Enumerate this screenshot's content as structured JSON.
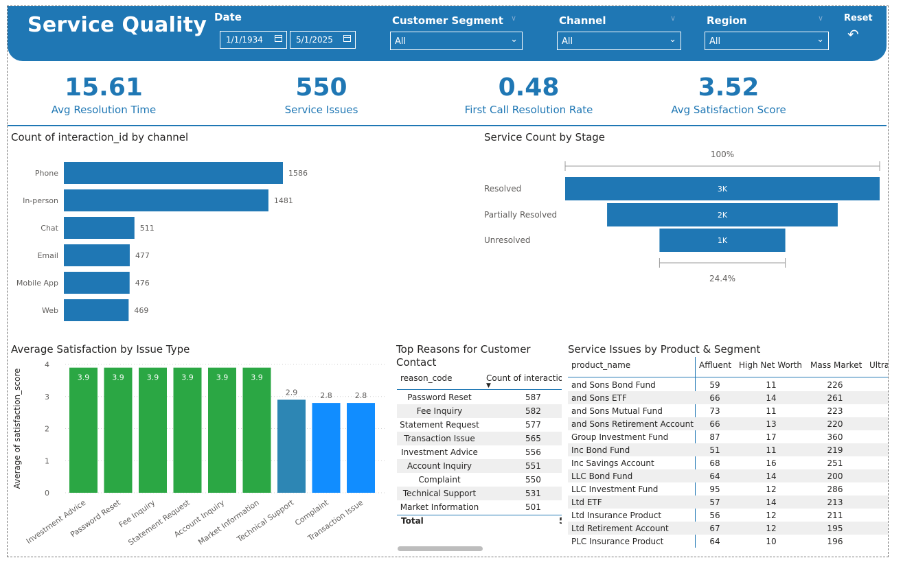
{
  "header": {
    "title": "Service Quality",
    "date_label": "Date",
    "date_start": "1/1/1934",
    "date_end": "5/1/2025",
    "filters": [
      {
        "label": "Customer Segment",
        "value": "All"
      },
      {
        "label": "Channel",
        "value": "All"
      },
      {
        "label": "Region",
        "value": "All"
      }
    ],
    "reset_label": "Reset"
  },
  "kpis": [
    {
      "value": "15.61",
      "label": "Avg Resolution Time"
    },
    {
      "value": "550",
      "label": "Service Issues"
    },
    {
      "value": "0.48",
      "label": "First Call Resolution Rate"
    },
    {
      "value": "3.52",
      "label": "Avg Satisfaction Score"
    }
  ],
  "colors": {
    "accent": "#1f77b4",
    "green": "#2ba744",
    "teal": "#2d86b4",
    "bright_blue": "#118dff",
    "bar": "#1f77b4"
  },
  "chart_data": [
    {
      "type": "bar",
      "orientation": "horizontal",
      "title": "Count of interaction_id by channel",
      "categories": [
        "Phone",
        "In-person",
        "Chat",
        "Email",
        "Mobile App",
        "Web"
      ],
      "values": [
        1586,
        1481,
        511,
        477,
        476,
        469
      ],
      "data_labels": [
        "1586",
        "1481",
        "511",
        "477",
        "476",
        "469"
      ]
    },
    {
      "type": "funnel",
      "title": "Service Count by Stage",
      "categories": [
        "Resolved",
        "Partially Resolved",
        "Unresolved"
      ],
      "values": [
        3000,
        2200,
        1200
      ],
      "data_labels": [
        "3K",
        "2K",
        "1K"
      ],
      "top_percent": "100%",
      "bottom_percent": "24.4%"
    },
    {
      "type": "bar",
      "title": "Average Satisfaction by Issue Type",
      "ylabel": "Average of satisfaction_score",
      "categories": [
        "Investment Advice",
        "Password Reset",
        "Fee Inquiry",
        "Statement Request",
        "Account Inquiry",
        "Market Information",
        "Technical Support",
        "Complaint",
        "Transaction Issue"
      ],
      "values": [
        3.9,
        3.9,
        3.9,
        3.9,
        3.9,
        3.9,
        2.9,
        2.8,
        2.8
      ],
      "data_labels": [
        "3.9",
        "3.9",
        "3.9",
        "3.9",
        "3.9",
        "3.9",
        "2.9",
        "2.8",
        "2.8"
      ],
      "bar_colors": [
        "#2ba744",
        "#2ba744",
        "#2ba744",
        "#2ba744",
        "#2ba744",
        "#2ba744",
        "#2d86b4",
        "#118dff",
        "#118dff"
      ],
      "ylim": [
        0,
        4
      ],
      "yticks": [
        "0",
        "1",
        "2",
        "3",
        "4"
      ],
      "grid": true
    }
  ],
  "reasons_table": {
    "title": "Top Reasons for Customer Contact",
    "columns": [
      "reason_code",
      "Count of interactio"
    ],
    "rows": [
      [
        "Password Reset",
        "587"
      ],
      [
        "Fee Inquiry",
        "582"
      ],
      [
        "Statement Request",
        "577"
      ],
      [
        "Transaction Issue",
        "565"
      ],
      [
        "Investment Advice",
        "556"
      ],
      [
        "Account Inquiry",
        "551"
      ],
      [
        "Complaint",
        "550"
      ],
      [
        "Technical Support",
        "531"
      ],
      [
        "Market Information",
        "501"
      ]
    ],
    "total_label": "Total",
    "total_value": "5"
  },
  "product_table": {
    "title": "Service Issues by Product & Segment",
    "columns": [
      "product_name",
      "Affluent",
      "High Net Worth",
      "Mass Market",
      "Ultra"
    ],
    "rows": [
      [
        "and Sons Bond Fund",
        "59",
        "11",
        "226"
      ],
      [
        "and Sons ETF",
        "66",
        "14",
        "261"
      ],
      [
        "and Sons Mutual Fund",
        "73",
        "11",
        "223"
      ],
      [
        "and Sons Retirement Account",
        "66",
        "13",
        "220"
      ],
      [
        "Group Investment Fund",
        "87",
        "17",
        "360"
      ],
      [
        "Inc Bond Fund",
        "51",
        "11",
        "219"
      ],
      [
        "Inc Savings Account",
        "68",
        "16",
        "251"
      ],
      [
        "LLC Bond Fund",
        "64",
        "14",
        "200"
      ],
      [
        "LLC Investment Fund",
        "95",
        "12",
        "286"
      ],
      [
        "Ltd ETF",
        "57",
        "14",
        "213"
      ],
      [
        "Ltd Insurance Product",
        "56",
        "12",
        "211"
      ],
      [
        "Ltd Retirement Account",
        "67",
        "12",
        "195"
      ],
      [
        "PLC Insurance Product",
        "64",
        "10",
        "196"
      ]
    ]
  }
}
